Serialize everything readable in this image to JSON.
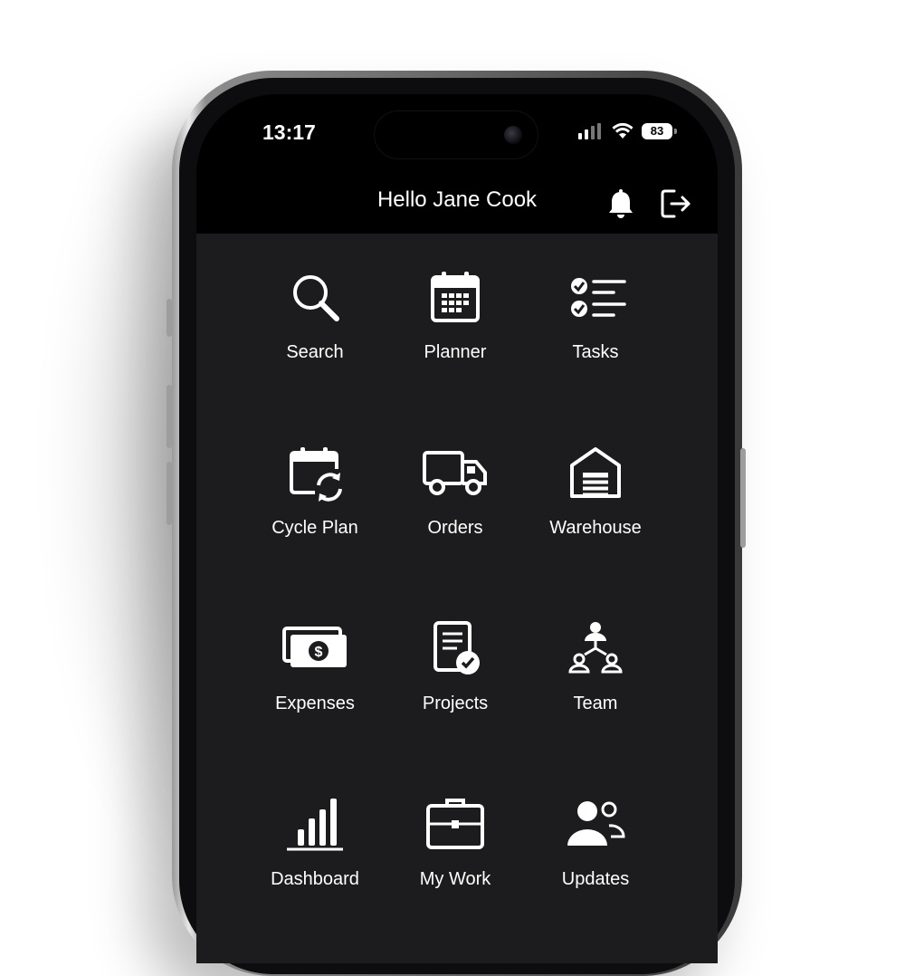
{
  "status_bar": {
    "time": "13:17",
    "battery": "83"
  },
  "header": {
    "greeting": "Hello Jane Cook"
  },
  "menu": [
    {
      "label": "Search",
      "icon": "search-icon"
    },
    {
      "label": "Planner",
      "icon": "calendar-icon"
    },
    {
      "label": "Tasks",
      "icon": "checklist-icon"
    },
    {
      "label": "Cycle Plan",
      "icon": "calendar-cycle-icon"
    },
    {
      "label": "Orders",
      "icon": "truck-icon"
    },
    {
      "label": "Warehouse",
      "icon": "warehouse-icon"
    },
    {
      "label": "Expenses",
      "icon": "money-icon"
    },
    {
      "label": "Projects",
      "icon": "document-check-icon"
    },
    {
      "label": "Team",
      "icon": "team-icon"
    },
    {
      "label": "Dashboard",
      "icon": "bar-chart-icon"
    },
    {
      "label": "My Work",
      "icon": "briefcase-icon"
    },
    {
      "label": "Updates",
      "icon": "people-icon"
    }
  ],
  "colors": {
    "screen_bg": "#1c1c1e",
    "header_bg": "#000000",
    "text": "#ffffff"
  }
}
